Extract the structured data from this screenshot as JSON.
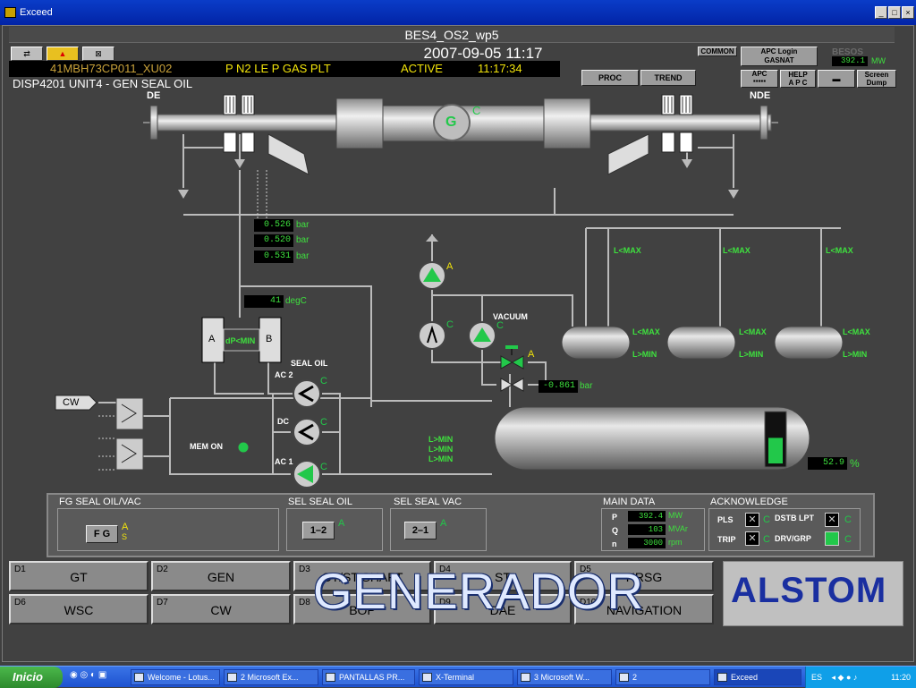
{
  "window": {
    "title": "Exceed"
  },
  "header": {
    "title": "BES4_OS2_wp5",
    "datetime": "2007-09-05  11:17",
    "tag": "41MBH73CP011_XU02",
    "alarm_text": "P N2 LE P GAS PLT",
    "alarm_state": "ACTIVE",
    "alarm_time": "11:17:34",
    "disp": "DISP4201  UNIT4 - GEN SEAL OIL",
    "buttons": {
      "proc": "PROC",
      "trend": "TREND",
      "common": "COMMON",
      "apc_login": "APC Login\nGASNAT",
      "apc": "APC",
      "help_apc": "HELP\nA P C",
      "screen_dump": "Screen\nDump",
      "besos": "BESOS"
    },
    "besos_value": "392.1",
    "besos_unit": "MW"
  },
  "schematic": {
    "de": "DE",
    "nde": "NDE",
    "gen_letter": "G",
    "gen_state": "C",
    "pressures": [
      {
        "value": "0.526",
        "unit": "bar"
      },
      {
        "value": "0.520",
        "unit": "bar"
      },
      {
        "value": "0.531",
        "unit": "bar"
      }
    ],
    "temp": {
      "value": "41",
      "unit": "degC"
    },
    "filter_a": "A",
    "filter_b": "B",
    "dp_min": "dP<MIN",
    "seal_oil": "SEAL OIL",
    "ac2": "AC 2",
    "dc": "DC",
    "ac1": "AC 1",
    "cw": "CW",
    "mem_on": "MEM ON",
    "vacuum": "VACUUM",
    "vac_value": "-0.861",
    "vac_unit": "bar",
    "lmax": "L<MAX",
    "lmin": "L>MIN",
    "tank_level": "52.9",
    "tank_unit": "%",
    "state_a": "A",
    "state_c": "C"
  },
  "panel": {
    "fg_seal_hdr": "FG SEAL OIL/VAC",
    "fg_btn": "F G",
    "fg_state": "A",
    "fg_sub": "S",
    "sel_oil_hdr": "SEL SEAL OIL",
    "sel_oil_btn": "1–2",
    "sel_oil_state": "A",
    "sel_vac_hdr": "SEL SEAL VAC",
    "sel_vac_btn": "2–1",
    "sel_vac_state": "A",
    "main_hdr": "MAIN DATA",
    "main": [
      {
        "label": "P",
        "value": "392.4",
        "unit": "MW"
      },
      {
        "label": "Q",
        "value": "103",
        "unit": "MVAr"
      },
      {
        "label": "n",
        "value": "3000",
        "unit": "rpm"
      }
    ],
    "ack_hdr": "ACKNOWLEDGE",
    "pls": "PLS",
    "trip": "TRIP",
    "dstb": "DSTB LPT",
    "drv": "DRV/GRP",
    "ack_c": "C"
  },
  "nav": [
    {
      "code": "D1",
      "label": "GT"
    },
    {
      "code": "D2",
      "label": "GEN"
    },
    {
      "code": "D3",
      "label": "GT/ST SHAFT"
    },
    {
      "code": "D4",
      "label": "ST"
    },
    {
      "code": "D5",
      "label": "HRSG"
    },
    {
      "code": "D6",
      "label": "WSC"
    },
    {
      "code": "D7",
      "label": "CW"
    },
    {
      "code": "D8",
      "label": "BOP"
    },
    {
      "code": "D9",
      "label": "DAE"
    },
    {
      "code": "D10",
      "label": "NAVIGATION"
    }
  ],
  "overlay_title": "GENERADOR",
  "logo": "ALSTOM",
  "taskbar": {
    "start": "Inicio",
    "items": [
      "Welcome - Lotus...",
      "2 Microsoft Ex...",
      "PANTALLAS PR...",
      "X-Terminal",
      "3 Microsoft W...",
      "2",
      "Exceed"
    ],
    "lang": "ES",
    "clock": "11:20"
  },
  "colors": {
    "green": "#3ee03e",
    "yellow": "#f2e40a",
    "bg": "#3f3f3f",
    "title_blue": "#0a3cc8"
  }
}
